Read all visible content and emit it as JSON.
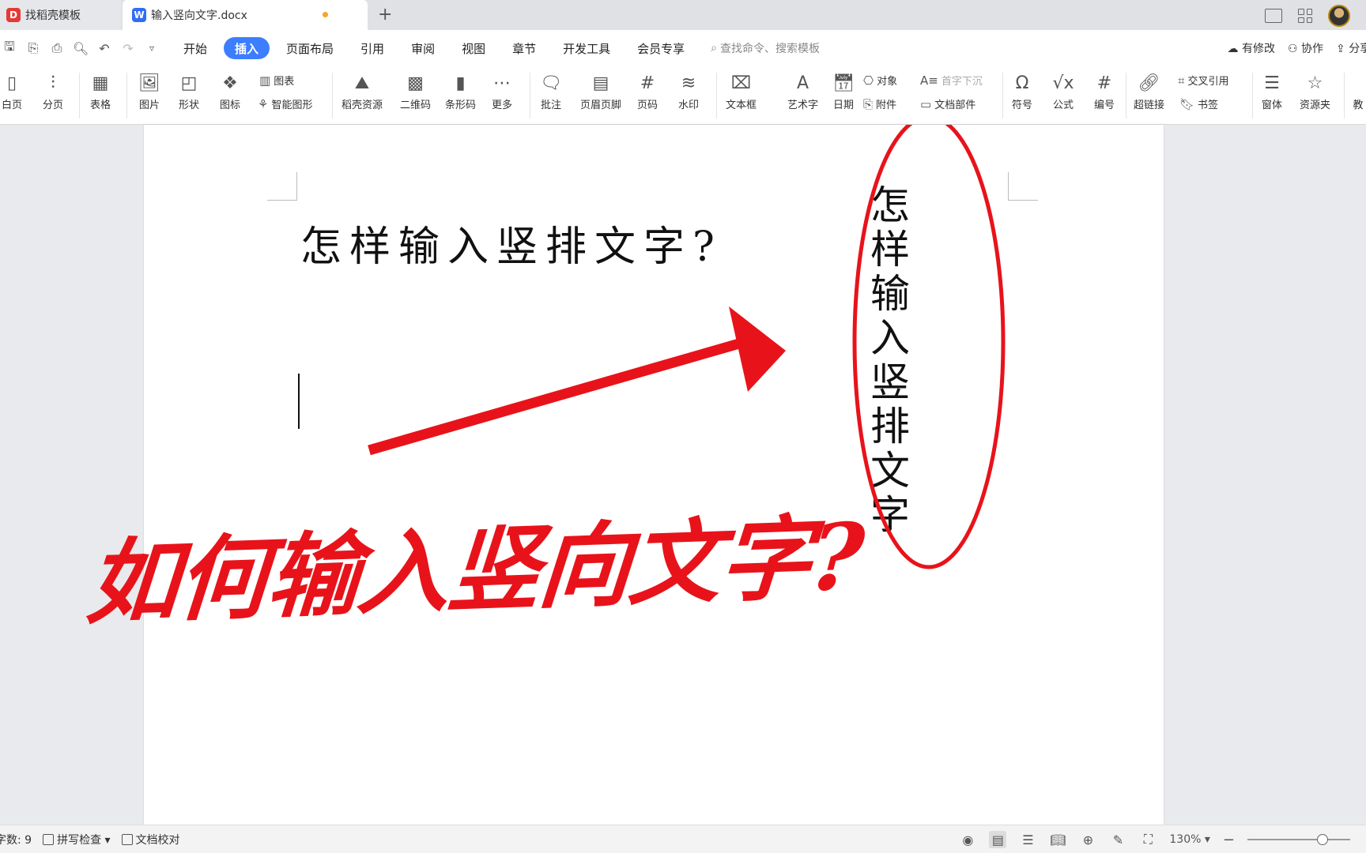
{
  "tabs": [
    {
      "label": "找稻壳模板",
      "logo": "D",
      "logo_color": "#e53935"
    },
    {
      "label": "输入竖向文字.docx",
      "logo": "W",
      "logo_color": "#2f6df6"
    }
  ],
  "menu": {
    "items": [
      "开始",
      "插入",
      "页面布局",
      "引用",
      "审阅",
      "视图",
      "章节",
      "开发工具",
      "会员专享"
    ],
    "active": "插入",
    "search_placeholder": "查找命令、搜索模板",
    "right": [
      "有修改",
      "协作",
      "分享"
    ]
  },
  "ribbon": {
    "blank_page": "白页",
    "page_break": "分页",
    "table": "表格",
    "picture": "图片",
    "shape": "形状",
    "icons": "图标",
    "chart": "图表",
    "smart_art": "智能图形",
    "docer_resources": "稻壳资源",
    "qrcode": "二维码",
    "barcode": "条形码",
    "more": "更多",
    "comment": "批注",
    "header_footer": "页眉页脚",
    "page_number": "页码",
    "watermark": "水印",
    "textbox": "文本框",
    "wordart": "艺术字",
    "date": "日期",
    "object": "对象",
    "attachment": "附件",
    "drop_cap": "首字下沉",
    "doc_parts": "文档部件",
    "symbol": "符号",
    "formula": "公式",
    "numbering": "编号",
    "hyperlink": "超链接",
    "cross_reference": "交叉引用",
    "bookmark": "书签",
    "form": "窗体",
    "resource_folder": "资源夹",
    "teach": "教"
  },
  "document": {
    "title": "怎样输入竖排文字?",
    "vertical_text": "怎样输入竖排文字",
    "annotation": "如何输入竖向文字?",
    "annotation_color": "#e8131a"
  },
  "status": {
    "word_count": "字数: 9",
    "spell_check": "拼写检查",
    "doc_proof": "文档校对",
    "zoom": "130%"
  }
}
